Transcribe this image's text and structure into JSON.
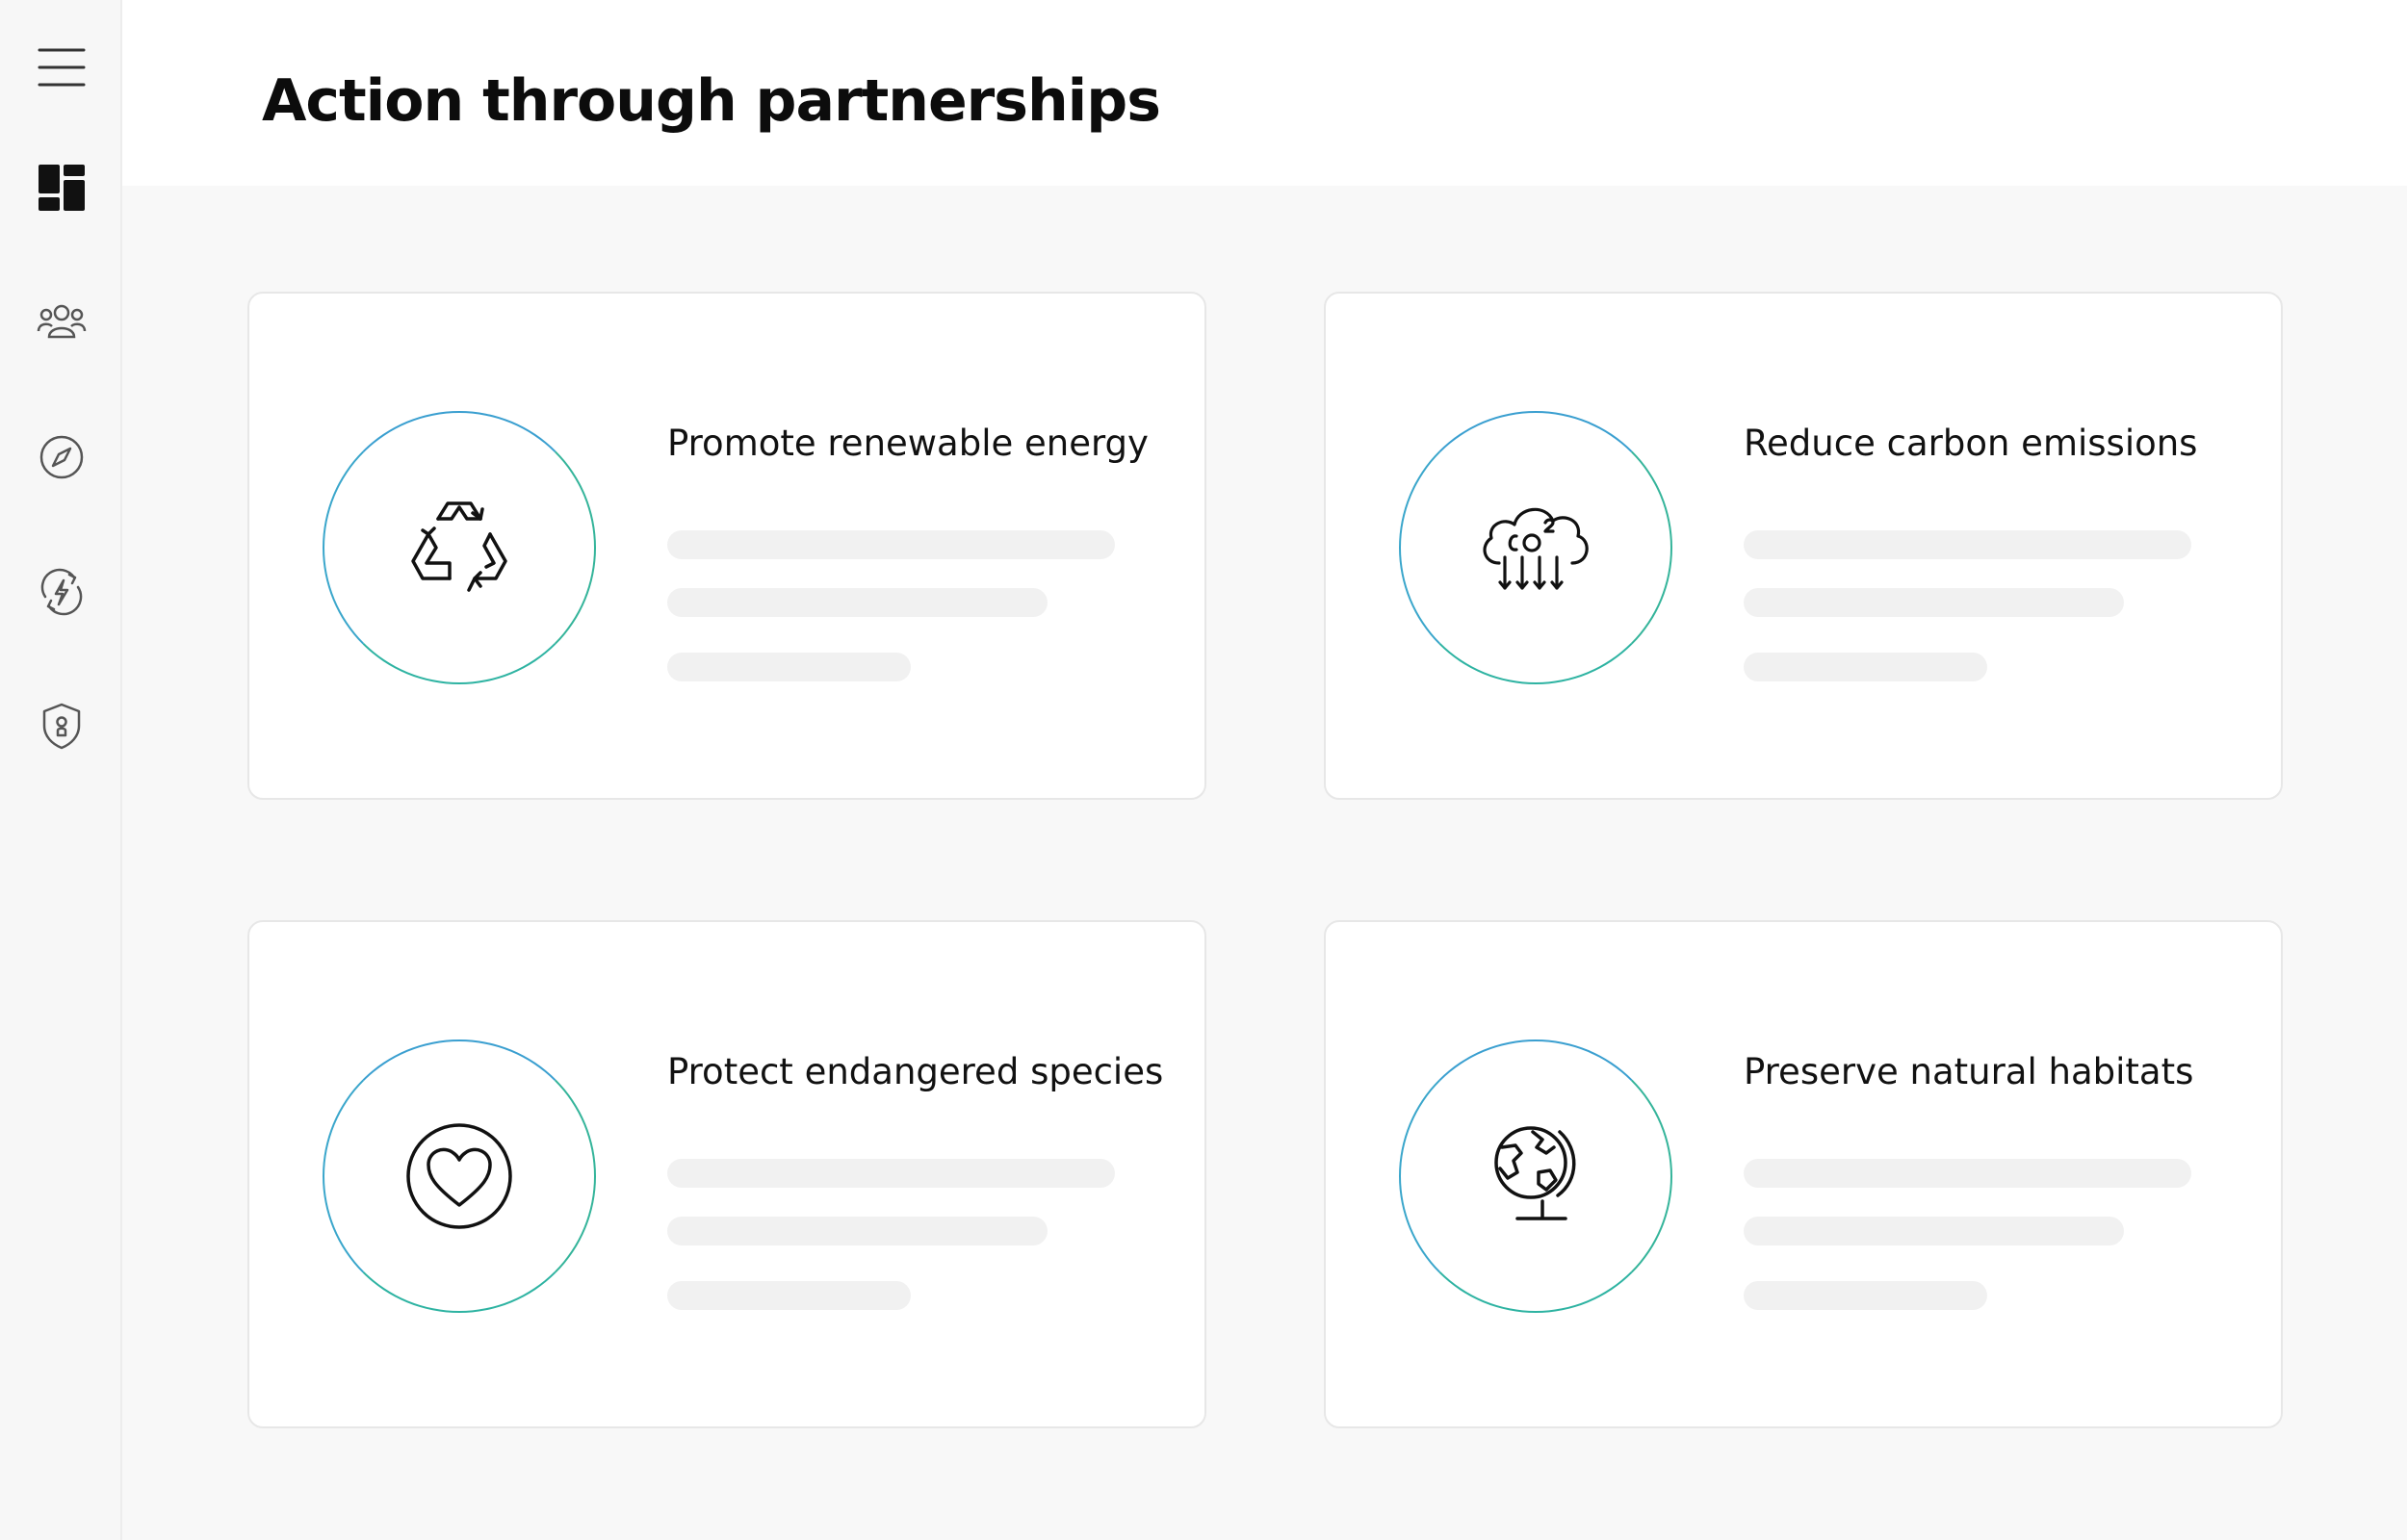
{
  "page": {
    "title": "Action through partnerships"
  },
  "sidebar": {
    "items": [
      {
        "icon": "menu-icon"
      },
      {
        "icon": "dashboard-icon",
        "active": true
      },
      {
        "icon": "people-icon"
      },
      {
        "icon": "compass-icon"
      },
      {
        "icon": "energy-icon"
      },
      {
        "icon": "shield-icon"
      }
    ]
  },
  "cards": [
    {
      "title": "Promote renewable energy",
      "icon": "recycle-icon"
    },
    {
      "title": "Reduce carbon emissions",
      "icon": "co2-cloud-icon"
    },
    {
      "title": "Protect endangered species",
      "icon": "heart-icon"
    },
    {
      "title": "Preserve natural habitats",
      "icon": "globe-icon"
    }
  ],
  "colors": {
    "accent_ring_blue": "#3a9fd0",
    "accent_ring_green": "#2eb3a2",
    "sidebar_bg": "#f7f7f7",
    "content_bg": "#f8f8f8",
    "placeholder": "#f1f1f1"
  }
}
